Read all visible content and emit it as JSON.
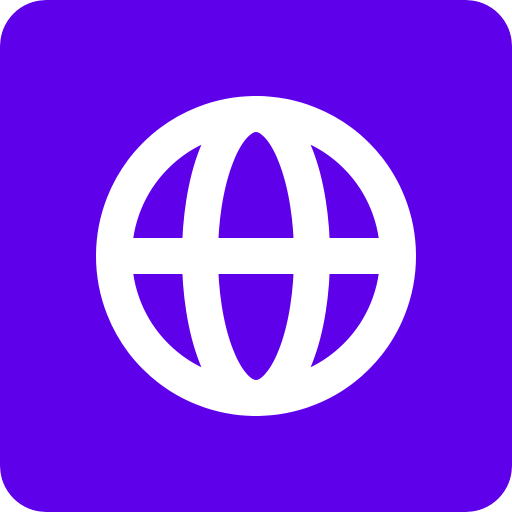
{
  "icon": {
    "name": "globe-icon",
    "background_color": "#5f00ea",
    "foreground_color": "#ffffff"
  }
}
